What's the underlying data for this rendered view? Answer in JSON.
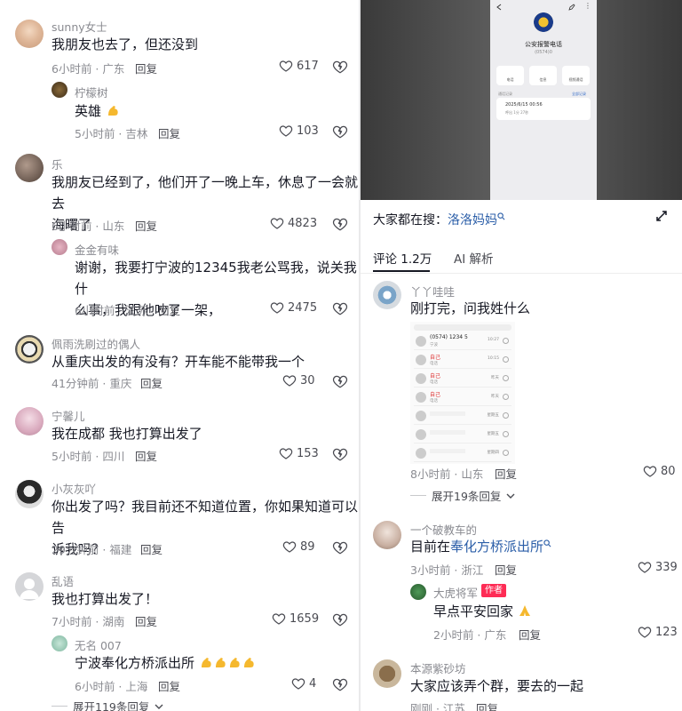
{
  "colors": {
    "link": "#2b5ea8",
    "author_badge": "#fe2c55",
    "muted": "#8a8b91"
  },
  "left": {
    "comments": [
      {
        "user": "sunny女士",
        "text": "我朋友也去了，但还没到",
        "meta": "6小时前 · 广东",
        "reply": "回复",
        "likes": "617"
      },
      {
        "user": "柠檬树",
        "text": "英雄",
        "meta": "5小时前 · 吉林",
        "reply": "回复",
        "likes": "103"
      },
      {
        "user": "乐",
        "text": "我朋友已经到了，他们开了一晚上车，休息了一会就去",
        "text2": "海曙了",
        "meta": "6小时前 · 山东",
        "reply": "回复",
        "likes": "4823"
      },
      {
        "user": "金金有味",
        "text": "谢谢，我要打宁波的12345我老公骂我，说关我什",
        "text2": "么事，我跟他吵了一架，",
        "meta": "6小时前 · 江苏",
        "reply": "回复",
        "likes": "2475"
      },
      {
        "user": "佩雨洗刷过的偶人",
        "text": "从重庆出发的有没有？开车能不能带我一个",
        "meta": "41分钟前 · 重庆",
        "reply": "回复",
        "likes": "30"
      },
      {
        "user": "宁馨儿",
        "text": "我在成都 我也打算出发了",
        "meta": "5小时前 · 四川",
        "reply": "回复",
        "likes": "153"
      },
      {
        "user": "小灰灰吖",
        "text": "你出发了吗？我目前还不知道位置，你如果知道可以告",
        "text2": "诉我吗？",
        "meta": "29分钟前 · 福建",
        "reply": "回复",
        "likes": "89"
      },
      {
        "user": "乱语",
        "text": "我也打算出发了！",
        "meta": "7小时前 · 湖南",
        "reply": "回复",
        "likes": "1659"
      },
      {
        "user": "无名 007",
        "text": "宁波奉化方桥派出所",
        "meta": "6小时前 · 上海",
        "reply": "回复",
        "likes": "4"
      }
    ],
    "expand": "展开119条回复"
  },
  "right": {
    "phone": {
      "title": "公安报警电话",
      "number": "(0574)0",
      "actions": [
        "电话",
        "信息",
        "视频通话"
      ],
      "recent_label": "通话记录",
      "recent_link": "全部记录",
      "call_time": "2025/6/15 00:56",
      "call_detail": "呼出 1分 27秒"
    },
    "search": {
      "prefix": "大家都在搜：",
      "term": "洛洛妈妈"
    },
    "tabs": {
      "comments": "评论 1.2万",
      "ai": "AI 解析"
    },
    "comments": [
      {
        "user": "丫丫哇哇",
        "text": "刚打完，问我姓什么",
        "meta": "8小时前 · 山东",
        "reply": "回复",
        "likes": "80"
      },
      {
        "user": "一个破教车的",
        "text_prefix": "目前在",
        "text_link": "奉化方桥派出所",
        "meta": "3小时前 · 浙江",
        "reply": "回复",
        "likes": "339"
      },
      {
        "user": "大虎将军",
        "badge": "作者",
        "text": "早点平安回家",
        "meta": "2小时前 · 广东",
        "reply": "回复",
        "likes": "123"
      },
      {
        "user": "本源紫砂坊",
        "text": "大家应该弄个群，要去的一起",
        "meta": "刚刚 · 江苏",
        "reply": "回复",
        "likes": ""
      }
    ],
    "expand": "展开19条回复",
    "call_list": [
      {
        "name": "(0574) 1234 5",
        "sub": "宁波",
        "time": "10:27"
      },
      {
        "name": "自己",
        "sub": "电话",
        "time": "10:15"
      },
      {
        "name": "自己",
        "sub": "电话",
        "time": "昨天"
      },
      {
        "name": "自己",
        "sub": "电话",
        "time": "昨天"
      },
      {
        "name": "",
        "sub": "",
        "time": "星期五"
      },
      {
        "name": "",
        "sub": "",
        "time": "星期五"
      },
      {
        "name": "",
        "sub": "",
        "time": "星期四"
      }
    ]
  }
}
